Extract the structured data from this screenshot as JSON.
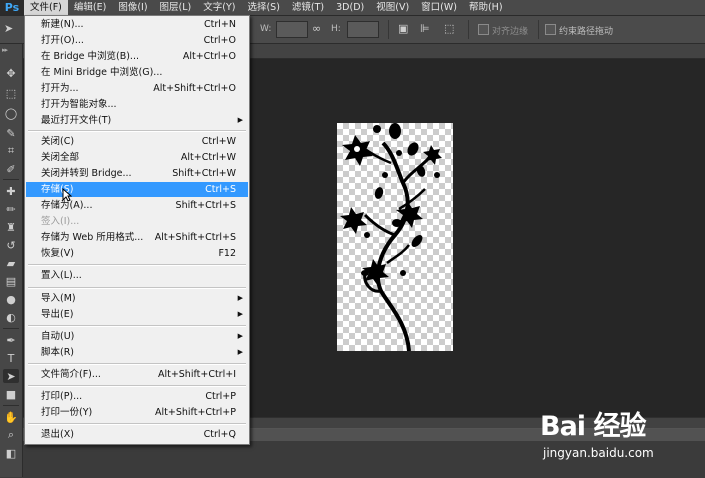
{
  "app": {
    "logo": "Ps"
  },
  "menubar": {
    "items": [
      "文件(F)",
      "编辑(E)",
      "图像(I)",
      "图层(L)",
      "文字(Y)",
      "选择(S)",
      "滤镜(T)",
      "3D(D)",
      "视图(V)",
      "窗口(W)",
      "帮助(H)"
    ]
  },
  "options_bar": {
    "w_label": "W:",
    "h_label": "H:",
    "align_edges_label": "对齐边缘",
    "constrain_path_label": "约束路径拖动"
  },
  "file_menu": {
    "items": [
      {
        "label": "新建(N)...",
        "shortcut": "Ctrl+N"
      },
      {
        "label": "打开(O)...",
        "shortcut": "Ctrl+O"
      },
      {
        "label": "在 Bridge 中浏览(B)...",
        "shortcut": "Alt+Ctrl+O"
      },
      {
        "label": "在 Mini Bridge 中浏览(G)...",
        "shortcut": ""
      },
      {
        "label": "打开为...",
        "shortcut": "Alt+Shift+Ctrl+O"
      },
      {
        "label": "打开为智能对象...",
        "shortcut": ""
      },
      {
        "label": "最近打开文件(T)",
        "shortcut": ""
      },
      {
        "label": "关闭(C)",
        "shortcut": "Ctrl+W"
      },
      {
        "label": "关闭全部",
        "shortcut": "Alt+Ctrl+W"
      },
      {
        "label": "关闭并转到 Bridge...",
        "shortcut": "Shift+Ctrl+W"
      },
      {
        "label": "存储(S)",
        "shortcut": "Ctrl+S"
      },
      {
        "label": "存储为(A)...",
        "shortcut": "Shift+Ctrl+S"
      },
      {
        "label": "签入(I)...",
        "shortcut": ""
      },
      {
        "label": "存储为 Web 所用格式...",
        "shortcut": "Alt+Shift+Ctrl+S"
      },
      {
        "label": "恢复(V)",
        "shortcut": "F12"
      },
      {
        "label": "置入(L)...",
        "shortcut": ""
      },
      {
        "label": "导入(M)",
        "shortcut": ""
      },
      {
        "label": "导出(E)",
        "shortcut": ""
      },
      {
        "label": "自动(U)",
        "shortcut": ""
      },
      {
        "label": "脚本(R)",
        "shortcut": ""
      },
      {
        "label": "文件简介(F)...",
        "shortcut": "Alt+Shift+Ctrl+I"
      },
      {
        "label": "打印(P)...",
        "shortcut": "Ctrl+P"
      },
      {
        "label": "打印一份(Y)",
        "shortcut": "Alt+Shift+Ctrl+P"
      },
      {
        "label": "退出(X)",
        "shortcut": "Ctrl+Q"
      }
    ]
  },
  "watermark": {
    "logo_text": "Bai 经验",
    "url": "jingyan.baidu.com"
  },
  "colors": {
    "highlight": "#3399ff",
    "canvas_background": "#262626",
    "silhouette": "#000000"
  }
}
